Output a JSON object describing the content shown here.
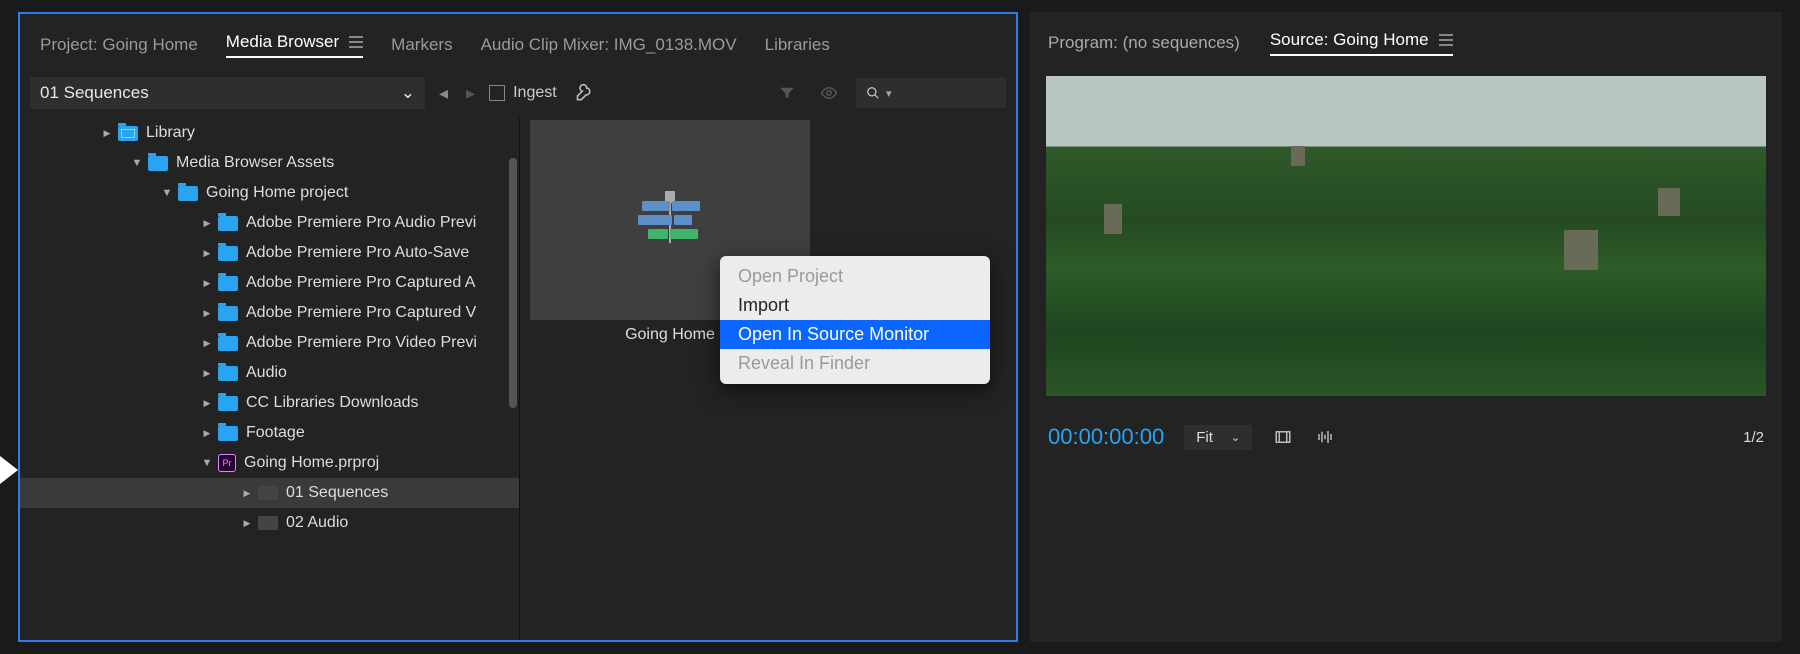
{
  "left": {
    "tabs": {
      "project": "Project: Going Home",
      "mediaBrowser": "Media Browser",
      "markers": "Markers",
      "audioClipMixer": "Audio Clip Mixer: IMG_0138.MOV",
      "libraries": "Libraries"
    },
    "toolbar": {
      "path": "01 Sequences",
      "ingest": "Ingest"
    },
    "tree": {
      "library": "Library",
      "mediaBrowserAssets": "Media Browser Assets",
      "goingHomeProject": "Going Home project",
      "children": {
        "audioPrev": "Adobe Premiere Pro Audio Previ",
        "autoSave": "Adobe Premiere Pro Auto-Save",
        "capturedA": "Adobe Premiere Pro Captured A",
        "capturedV": "Adobe Premiere Pro Captured V",
        "videoPrev": "Adobe Premiere Pro Video Previ",
        "audio": "Audio",
        "ccLib": "CC Libraries Downloads",
        "footage": "Footage",
        "prproj": "Going Home.prproj",
        "seq01": "01 Sequences",
        "audio02": "02 Audio"
      },
      "prBadge": "Pr"
    },
    "thumb": {
      "label": "Going Home"
    },
    "contextMenu": {
      "openProject": "Open Project",
      "import": "Import",
      "openInSource": "Open In Source Monitor",
      "revealFinder": "Reveal In Finder"
    }
  },
  "right": {
    "tabs": {
      "program": "Program: (no sequences)",
      "source": "Source: Going Home"
    },
    "controls": {
      "timecode": "00:00:00:00",
      "fit": "Fit",
      "page": "1/2"
    }
  }
}
